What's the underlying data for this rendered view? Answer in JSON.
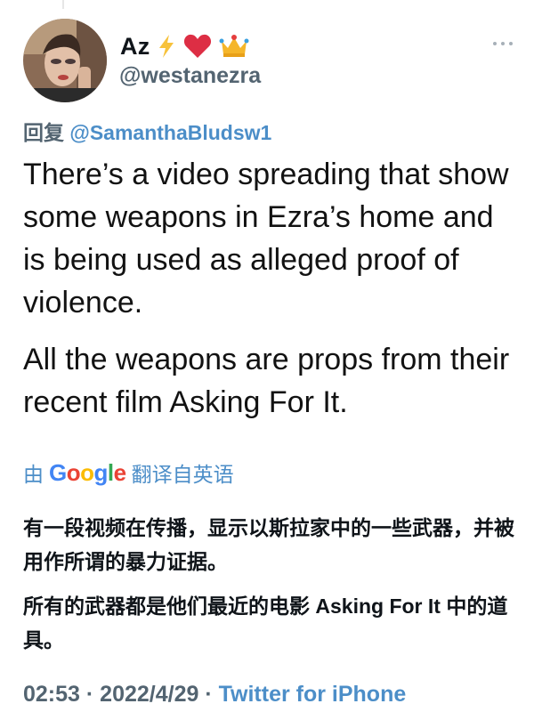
{
  "author": {
    "display_name": "Az",
    "emoji_icons": [
      "lightning-icon",
      "heart-icon",
      "crown-icon"
    ],
    "handle": "@westanezra"
  },
  "reply": {
    "prefix": "回复",
    "mention": "@SamanthaBludsw1"
  },
  "tweet": {
    "paragraphs": [
      "There’s a video spreading that show some weapons in Ezra’s home and is being used as alleged proof of violence.",
      "All the weapons are props from their recent film Asking For It."
    ]
  },
  "translation_banner": {
    "prefix": "由",
    "provider": "Google",
    "suffix": "翻译自英语"
  },
  "translation": {
    "paragraphs": [
      "有一段视频在传播，显示以斯拉家中的一些武器，并被用作所谓的暴力证据。",
      "所有的武器都是他们最近的电影 Asking For It 中的道具。"
    ]
  },
  "meta": {
    "time": "02:53",
    "separator": " · ",
    "date": "2022/4/29",
    "source": "Twitter for iPhone"
  },
  "colors": {
    "link_blue": "#4c8ec8",
    "secondary_text": "#536471",
    "google_blue": "#4285f4",
    "google_red": "#ea4335",
    "google_yellow": "#fbbc05",
    "google_green": "#34a853"
  }
}
